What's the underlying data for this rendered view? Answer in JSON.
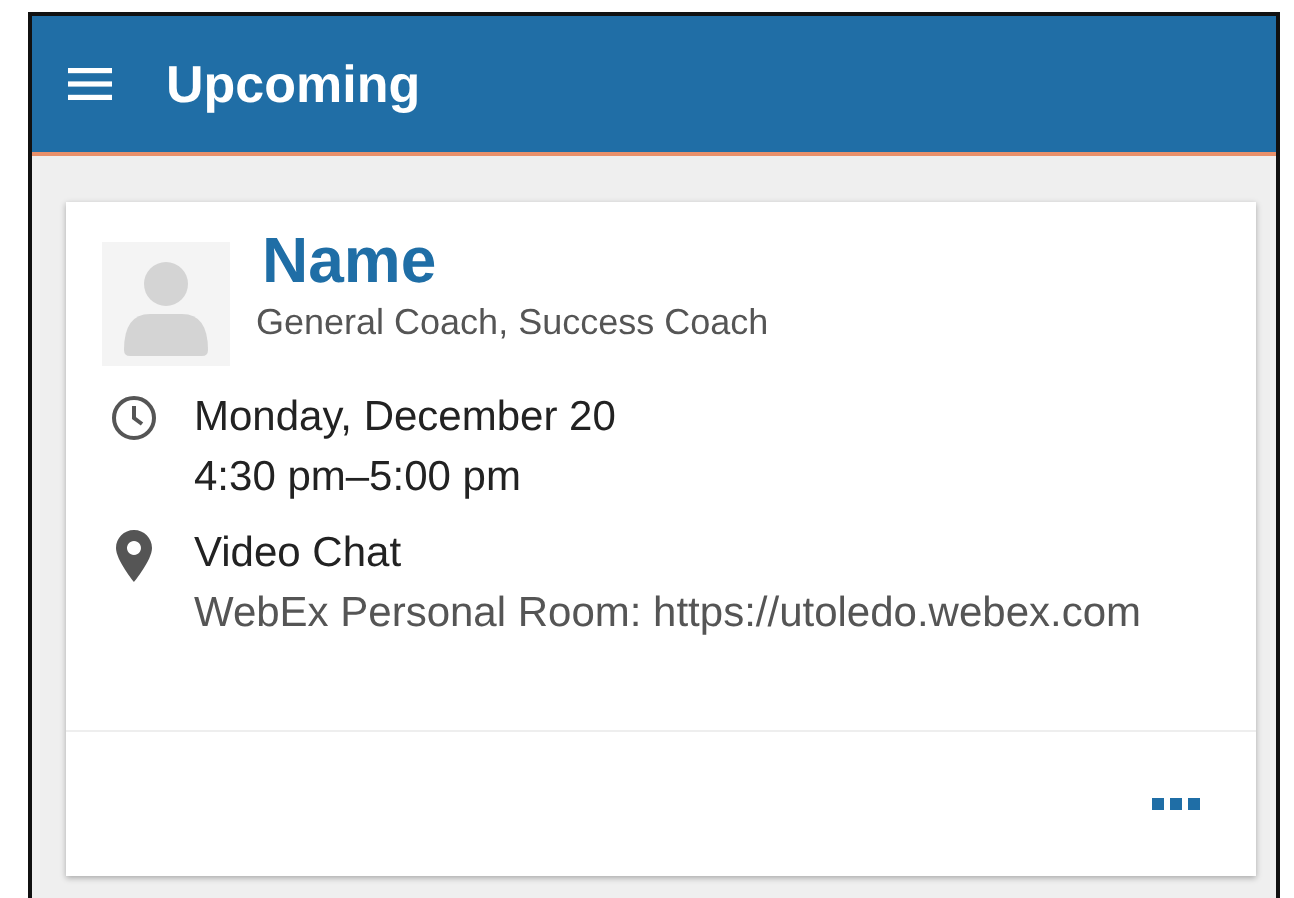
{
  "header": {
    "title": "Upcoming"
  },
  "appointment": {
    "name": "Name",
    "roles": "General Coach, Success Coach",
    "date": "Monday, December 20",
    "time": "4:30 pm–5:00 pm",
    "location": "Video Chat",
    "location_detail": "WebEx Personal Room: https://utoledo.webex.com"
  }
}
